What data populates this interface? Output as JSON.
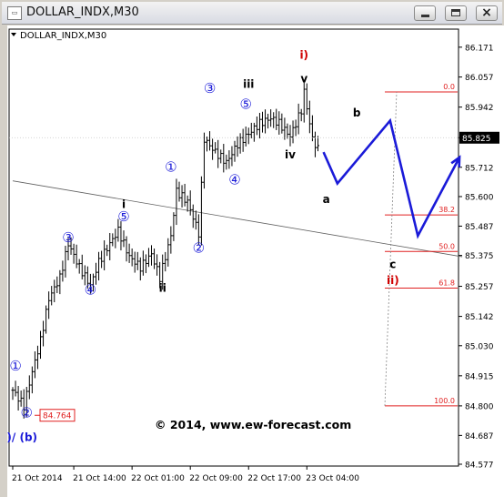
{
  "window": {
    "title": "DOLLAR_INDX,M30",
    "app_icon": "chart-window-icon"
  },
  "chart": {
    "header": "DOLLAR_INDX,M30",
    "watermark": "© 2014, www.ew-forecast.com",
    "current_price": "85.825",
    "low_price_label": "84.764",
    "colors": {
      "price_bars": "#000000",
      "projection": "#1a1ad8",
      "fib": "#e02020",
      "trendline": "#606060",
      "current_box": "#000000"
    }
  },
  "chart_data": {
    "type": "ohlc-bar",
    "ylim": [
      84.57,
      86.24
    ],
    "yticks": [
      "86.171",
      "86.057",
      "85.942",
      "85.825",
      "85.712",
      "85.600",
      "85.487",
      "85.375",
      "85.257",
      "85.142",
      "85.030",
      "84.915",
      "84.800",
      "84.687",
      "84.577"
    ],
    "xticks": [
      "21 Oct 2014",
      "21 Oct 14:00",
      "22 Oct 01:00",
      "22 Oct 09:00",
      "22 Oct 17:00",
      "23 Oct 04:00"
    ],
    "bar_count": 120,
    "price_path": [
      [
        0,
        84.86
      ],
      [
        4,
        84.8
      ],
      [
        7,
        84.93
      ],
      [
        10,
        85.05
      ],
      [
        13,
        85.21
      ],
      [
        17,
        85.29
      ],
      [
        20,
        85.42
      ],
      [
        24,
        85.33
      ],
      [
        28,
        85.26
      ],
      [
        31,
        85.35
      ],
      [
        35,
        85.42
      ],
      [
        38,
        85.47
      ],
      [
        42,
        85.37
      ],
      [
        46,
        85.33
      ],
      [
        50,
        85.38
      ],
      [
        53,
        85.29
      ],
      [
        57,
        85.45
      ],
      [
        59,
        85.62
      ],
      [
        63,
        85.58
      ],
      [
        67,
        85.46
      ],
      [
        69,
        85.82
      ],
      [
        73,
        85.77
      ],
      [
        77,
        85.73
      ],
      [
        81,
        85.8
      ],
      [
        85,
        85.84
      ],
      [
        89,
        85.88
      ],
      [
        93,
        85.9
      ],
      [
        96,
        85.88
      ],
      [
        100,
        85.83
      ],
      [
        104,
        85.93
      ],
      [
        105,
        86.0
      ],
      [
        108,
        85.82
      ],
      [
        110,
        85.78
      ]
    ],
    "fib_levels": [
      {
        "label": "0.0",
        "price": 86.0
      },
      {
        "label": "38.2",
        "price": 85.53
      },
      {
        "label": "50.0",
        "price": 85.39
      },
      {
        "label": "61.8",
        "price": 85.25
      },
      {
        "label": "100.0",
        "price": 84.8
      }
    ],
    "projection": [
      [
        112,
        85.77
      ],
      [
        117,
        85.65
      ],
      [
        136,
        85.89
      ],
      [
        146,
        85.45
      ],
      [
        161,
        85.75
      ]
    ],
    "trendline": [
      [
        0,
        85.66
      ],
      [
        162,
        85.37
      ]
    ],
    "wave_labels": [
      {
        "text": "①",
        "bar": 1,
        "price": 84.95,
        "color": "blue",
        "circled": true
      },
      {
        "text": "②",
        "bar": 5,
        "price": 84.77,
        "color": "blue",
        "circled": true
      },
      {
        "text": "ii)/ (b)",
        "bar": 2,
        "price": 84.68,
        "color": "blue"
      },
      {
        "text": "③",
        "bar": 20,
        "price": 85.44,
        "color": "blue",
        "circled": true
      },
      {
        "text": "④",
        "bar": 28,
        "price": 85.24,
        "color": "blue",
        "circled": true
      },
      {
        "text": "⑤",
        "bar": 40,
        "price": 85.52,
        "color": "blue",
        "circled": true
      },
      {
        "text": "i",
        "bar": 40,
        "price": 85.57,
        "color": "black"
      },
      {
        "text": "ii",
        "bar": 54,
        "price": 85.25,
        "color": "black"
      },
      {
        "text": "①",
        "bar": 57,
        "price": 85.71,
        "color": "blue",
        "circled": true
      },
      {
        "text": "②",
        "bar": 67,
        "price": 85.4,
        "color": "blue",
        "circled": true
      },
      {
        "text": "③",
        "bar": 71,
        "price": 86.01,
        "color": "blue",
        "circled": true
      },
      {
        "text": "④",
        "bar": 80,
        "price": 85.66,
        "color": "blue",
        "circled": true
      },
      {
        "text": "⑤",
        "bar": 84,
        "price": 85.95,
        "color": "blue",
        "circled": true
      },
      {
        "text": "iii",
        "bar": 85,
        "price": 86.03,
        "color": "black"
      },
      {
        "text": "iv",
        "bar": 100,
        "price": 85.76,
        "color": "black"
      },
      {
        "text": "v",
        "bar": 105,
        "price": 86.05,
        "color": "black"
      },
      {
        "text": "i)",
        "bar": 105,
        "price": 86.14,
        "color": "red"
      },
      {
        "text": "a",
        "bar": 113,
        "price": 85.59,
        "color": "black"
      },
      {
        "text": "b",
        "bar": 124,
        "price": 85.92,
        "color": "black"
      },
      {
        "text": "c",
        "bar": 137,
        "price": 85.34,
        "color": "black"
      },
      {
        "text": "ii)",
        "bar": 137,
        "price": 85.28,
        "color": "red"
      }
    ]
  }
}
